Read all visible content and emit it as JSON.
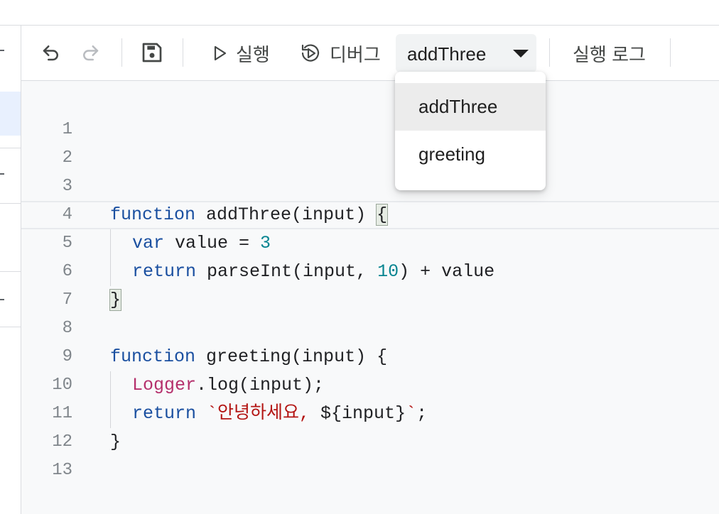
{
  "toolbar": {
    "undo_icon": "undo-icon",
    "redo_icon": "redo-icon",
    "save_icon": "save-icon",
    "run_label": "실행",
    "debug_label": "디버그",
    "selected_function": "addThree",
    "execution_log_label": "실행 로그"
  },
  "function_dropdown": {
    "options": [
      "addThree",
      "greeting"
    ],
    "selected": "addThree"
  },
  "editor": {
    "current_line": 4,
    "lines": [
      {
        "number": "1"
      },
      {
        "number": "2"
      },
      {
        "number": "3"
      },
      {
        "number": "4",
        "tokens": {
          "kw": "function",
          "rest": " addThree(input) ",
          "brace": "{"
        }
      },
      {
        "number": "5",
        "tokens": {
          "kw": "var",
          "mid": " value = ",
          "num": "3"
        }
      },
      {
        "number": "6",
        "tokens": {
          "kw": "return",
          "mid": " parseInt(input, ",
          "num": "10",
          "rest": ") + value"
        }
      },
      {
        "number": "7",
        "tokens": {
          "brace": "}"
        }
      },
      {
        "number": "8"
      },
      {
        "number": "9",
        "tokens": {
          "kw": "function",
          "rest": " greeting(input) {"
        }
      },
      {
        "number": "10",
        "tokens": {
          "obj": "Logger",
          "rest": ".log(input);"
        }
      },
      {
        "number": "11",
        "tokens": {
          "kw": "return",
          "sp": " ",
          "str": "`안녕하세요, ",
          "tpl": "${input}",
          "str_end": "`",
          "end": ";"
        }
      },
      {
        "number": "12",
        "tokens": {
          "rest": "}"
        }
      },
      {
        "number": "13"
      }
    ]
  }
}
